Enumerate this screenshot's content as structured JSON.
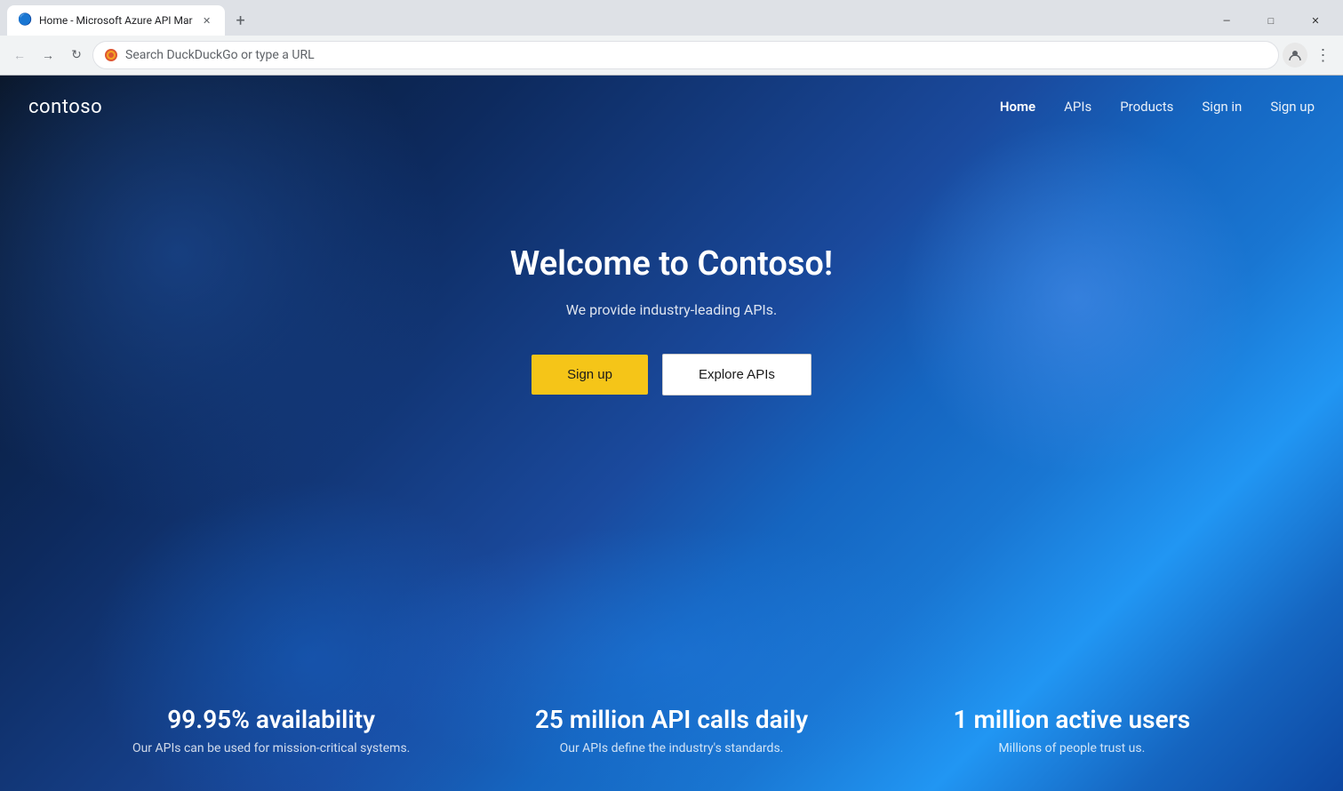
{
  "browser": {
    "tab": {
      "title": "Home - Microsoft Azure API Mar",
      "favicon": "🔵"
    },
    "new_tab_label": "+",
    "window_controls": {
      "minimize": "—",
      "maximize": "□",
      "close": "✕"
    },
    "address_bar": {
      "placeholder": "Search DuckDuckGo or type a URL",
      "value": "Search DuckDuckGo or type a URL"
    }
  },
  "site": {
    "logo": "contoso",
    "nav": {
      "links": [
        {
          "label": "Home",
          "active": true
        },
        {
          "label": "APIs",
          "active": false
        },
        {
          "label": "Products",
          "active": false
        },
        {
          "label": "Sign in",
          "active": false
        },
        {
          "label": "Sign up",
          "active": false
        }
      ]
    },
    "hero": {
      "title": "Welcome to Contoso!",
      "subtitle": "We provide industry-leading APIs.",
      "signup_btn": "Sign up",
      "explore_btn": "Explore APIs"
    },
    "stats": [
      {
        "value": "99.95% availability",
        "desc": "Our APIs can be used for mission-critical systems."
      },
      {
        "value": "25 million API calls daily",
        "desc": "Our APIs define the industry's standards."
      },
      {
        "value": "1 million active users",
        "desc": "Millions of people trust us."
      }
    ]
  }
}
